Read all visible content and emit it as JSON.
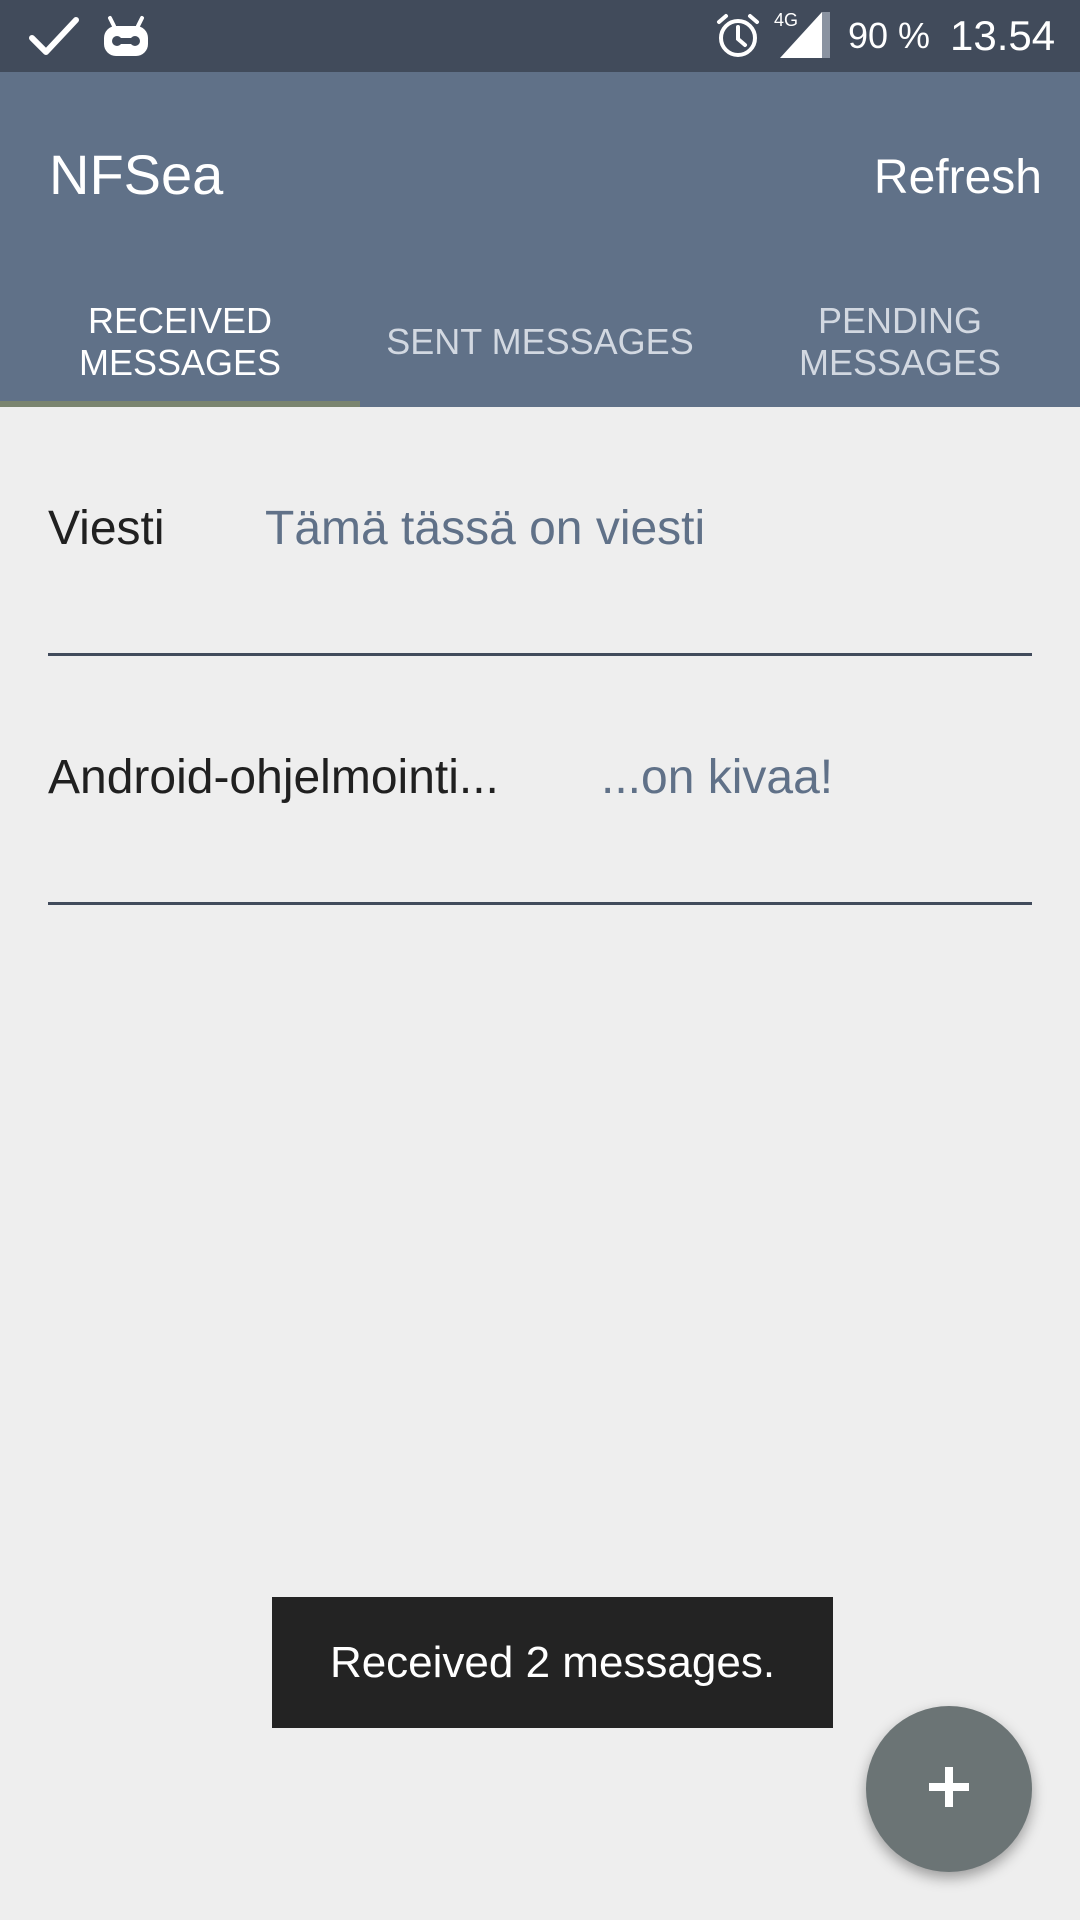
{
  "status_bar": {
    "left_icons": [
      "check-icon",
      "android-bot-icon"
    ],
    "right_icons": [
      "alarm-clock-icon",
      "signal-4g-icon"
    ],
    "network_label": "4G",
    "battery": "90 %",
    "time": "13.54"
  },
  "app_bar": {
    "title": "NFSea",
    "refresh_label": "Refresh",
    "tabs": [
      {
        "label": "RECEIVED\nMESSAGES",
        "selected": true
      },
      {
        "label": "SENT MESSAGES",
        "selected": false
      },
      {
        "label": "PENDING\nMESSAGES",
        "selected": false
      }
    ]
  },
  "messages": [
    {
      "title": "Viesti",
      "body": "Tämä tässä on viesti"
    },
    {
      "title": "Android-ohjelmointi...",
      "body": "...on kivaa!"
    }
  ],
  "toast": {
    "text": "Received 2 messages."
  },
  "fab": {
    "icon": "plus-icon"
  },
  "colors": {
    "status_bar": "#414b5b",
    "app_bar": "#607188",
    "background": "#eeeeee",
    "accent_text": "#607188",
    "fab": "#6b7475",
    "toast": "#232323"
  }
}
